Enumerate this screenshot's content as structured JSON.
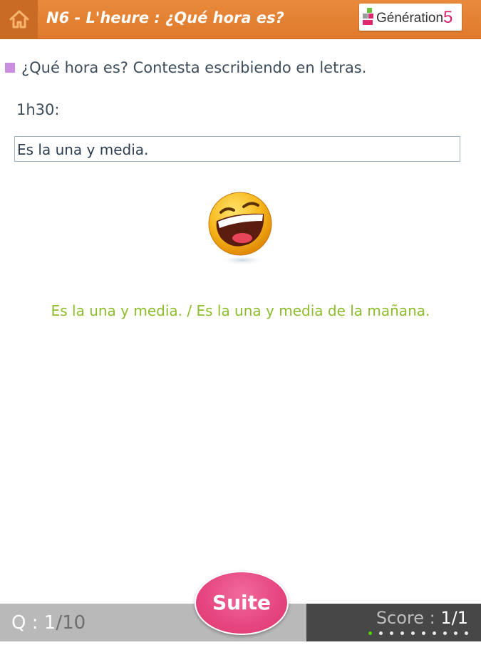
{
  "header": {
    "title": "N6 - L'heure : ¿Qué hora es?",
    "home_icon": "home-icon",
    "logo": {
      "text": "Génération",
      "number": "5",
      "accent_color": "#d6226e"
    }
  },
  "colors": {
    "header_bg": "#e07a2b",
    "question_text": "#3c4c5a",
    "correction_text": "#8dbd2c",
    "suite_button": "#e6457f",
    "progress_active": "#55d400"
  },
  "question": {
    "instruction": "¿Qué hora es? Contesta escribiendo en letras.",
    "prompt": "1h30:",
    "answer_value": "Es la una y media.",
    "feedback_icon": "laughing-smiley-icon",
    "correction": "Es la una y media. / Es la una y media de la mañana."
  },
  "footer": {
    "q_label": "Q : ",
    "q_current": "1",
    "q_total": "/10",
    "score_label": "Score : ",
    "score_value": "1/1",
    "progress_current": 1,
    "progress_total": 10,
    "suite_label": "Suite"
  }
}
